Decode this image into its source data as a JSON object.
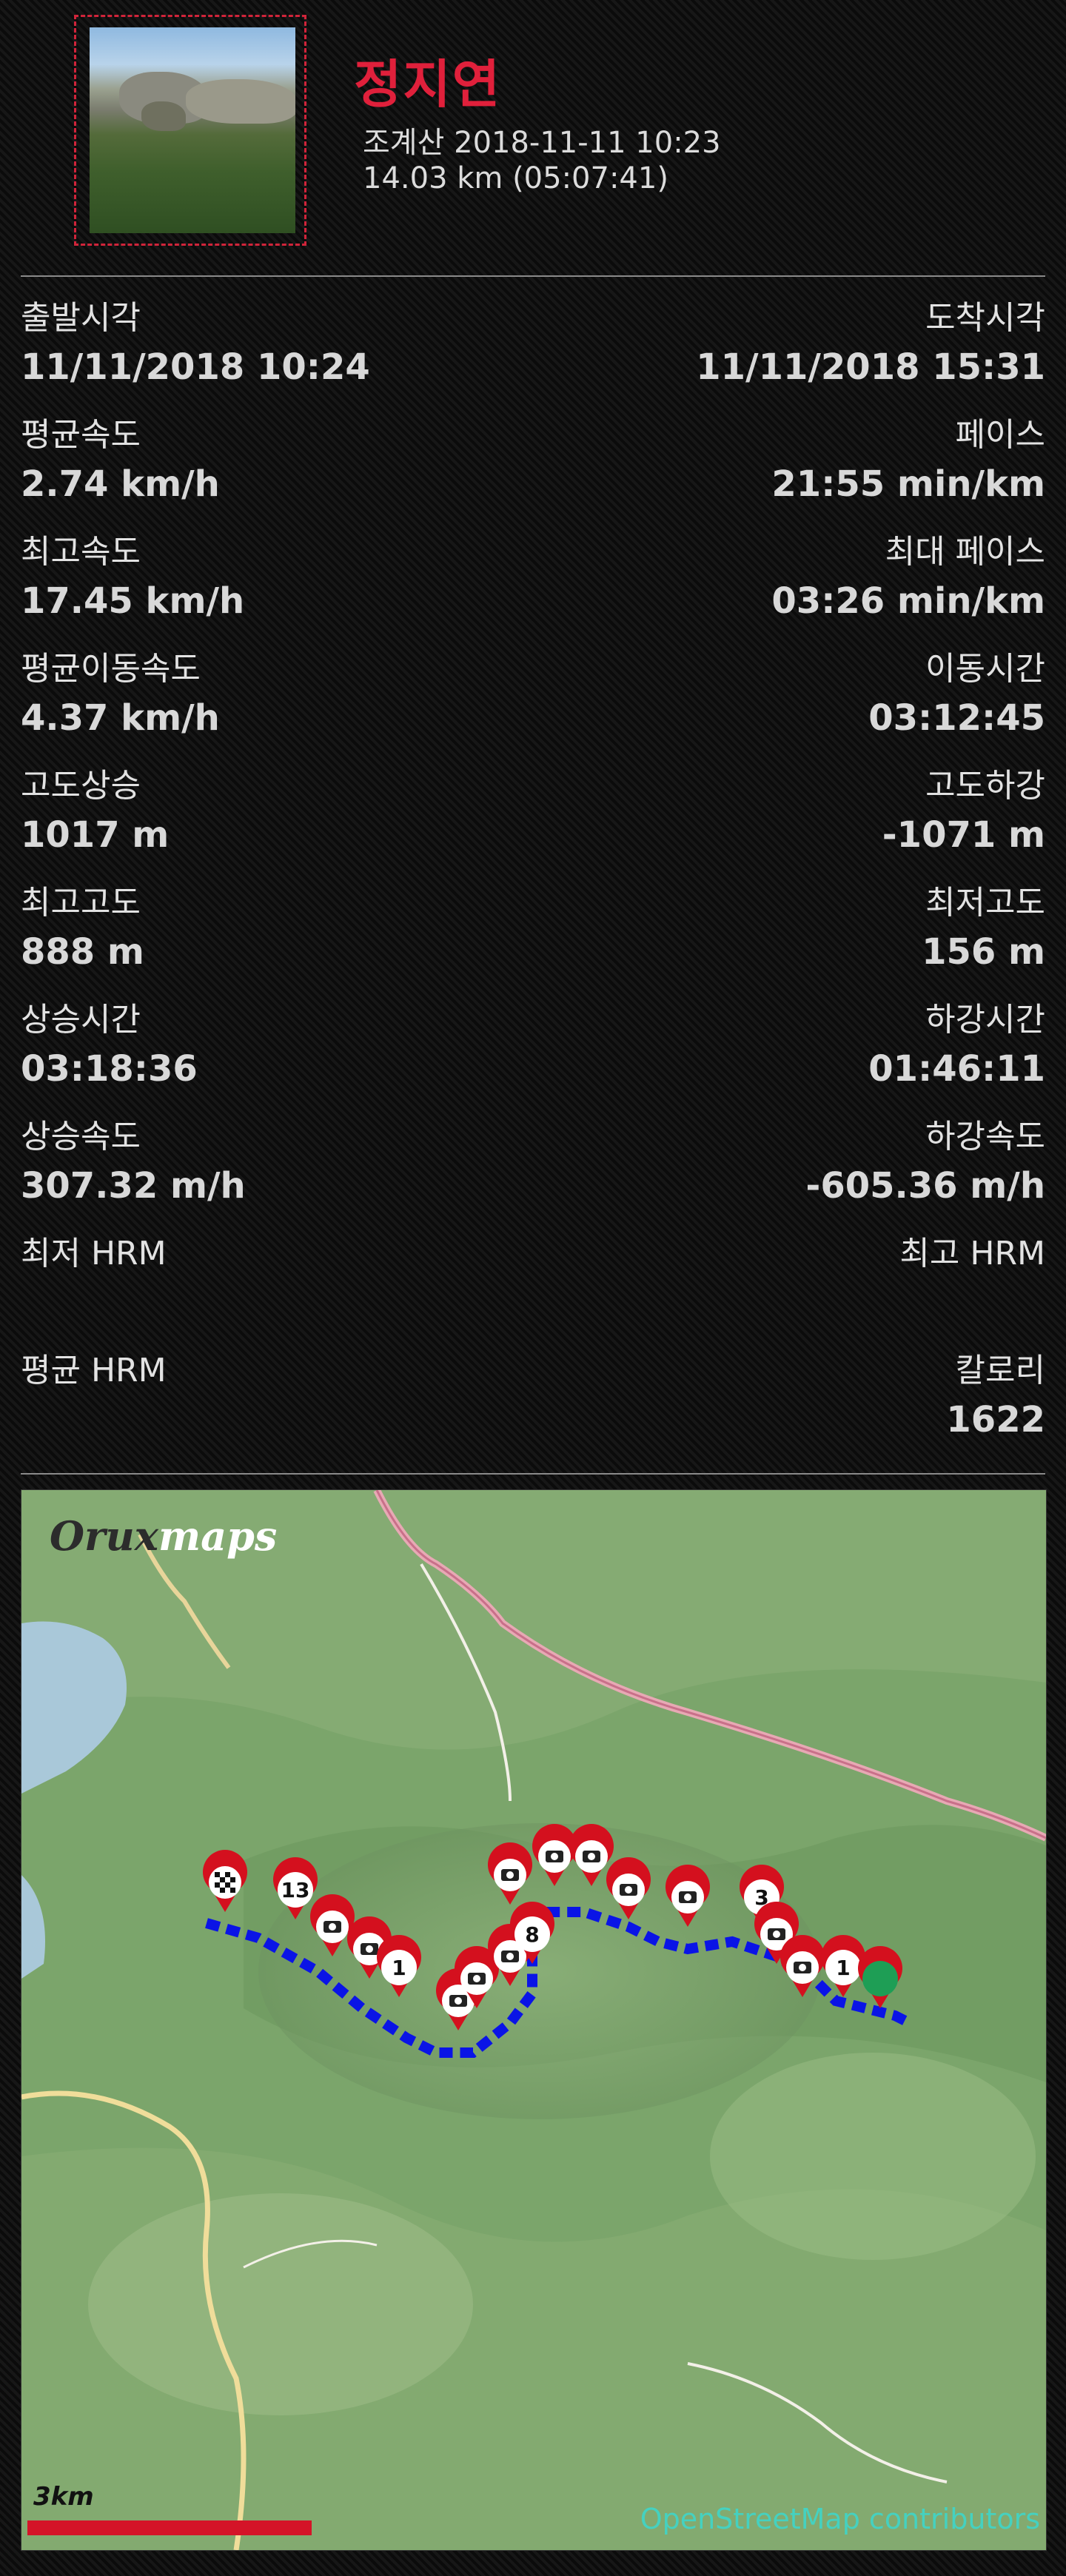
{
  "header": {
    "name": "정지연",
    "subtitle": "조계산 2018-11-11 10:23",
    "summary": "14.03 km (05:07:41)"
  },
  "stats": [
    {
      "left_label": "출발시각",
      "left_value": "11/11/2018 10:24",
      "right_label": "도착시각",
      "right_value": "11/11/2018 15:31"
    },
    {
      "left_label": "평균속도",
      "left_value": "2.74 km/h",
      "right_label": "페이스",
      "right_value": "21:55 min/km"
    },
    {
      "left_label": "최고속도",
      "left_value": "17.45 km/h",
      "right_label": "최대 페이스",
      "right_value": "03:26 min/km"
    },
    {
      "left_label": "평균이동속도",
      "left_value": "4.37 km/h",
      "right_label": "이동시간",
      "right_value": "03:12:45"
    },
    {
      "left_label": "고도상승",
      "left_value": "1017 m",
      "right_label": "고도하강",
      "right_value": "-1071 m"
    },
    {
      "left_label": "최고고도",
      "left_value": "888 m",
      "right_label": "최저고도",
      "right_value": "156 m"
    },
    {
      "left_label": "상승시간",
      "left_value": "03:18:36",
      "right_label": "하강시간",
      "right_value": "01:46:11"
    },
    {
      "left_label": "상승속도",
      "left_value": "307.32 m/h",
      "right_label": "하강속도",
      "right_value": "-605.36 m/h"
    },
    {
      "left_label": "최저 HRM",
      "left_value": "",
      "right_label": "최고 HRM",
      "right_value": ""
    },
    {
      "left_label": "평균 HRM",
      "left_value": "",
      "right_label": "칼로리",
      "right_value": "1622"
    }
  ],
  "map": {
    "logo_dark": "Orux",
    "logo_light": "maps",
    "scale_label": "3km",
    "attribution": "OpenStreetMap contributors",
    "marker_numbers": [
      "13",
      "1",
      "8",
      "3",
      "1"
    ],
    "colors": {
      "accent": "#e0203b",
      "track": "#0a14e6",
      "marker": "#d4101e",
      "start": "#1e9e55"
    }
  }
}
